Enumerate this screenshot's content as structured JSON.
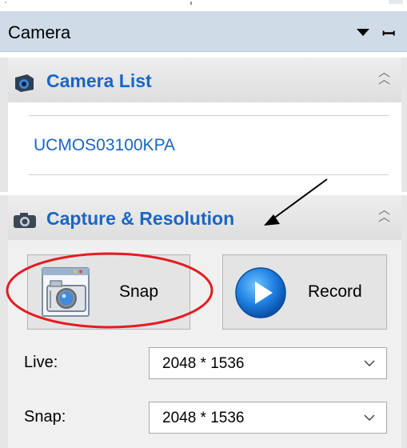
{
  "panel": {
    "title": "Camera"
  },
  "camera_list": {
    "title": "Camera List",
    "items": [
      {
        "name": "UCMOS03100KPA"
      }
    ]
  },
  "capture": {
    "title": "Capture & Resolution",
    "snap_label": "Snap",
    "record_label": "Record",
    "live_label": "Live:",
    "live_value": "2048 * 1536",
    "snap_res_label": "Snap:",
    "snap_value": "2048 * 1536"
  },
  "colors": {
    "accent": "#1a66c4",
    "annotation_circle": "#e41c23",
    "annotation_arrow": "#000000"
  },
  "icons": [
    "dropdown-arrow-icon",
    "pin-icon",
    "camera-icon",
    "collapse-icon",
    "snap-camera-icon",
    "record-play-icon",
    "chevron-down-icon"
  ]
}
